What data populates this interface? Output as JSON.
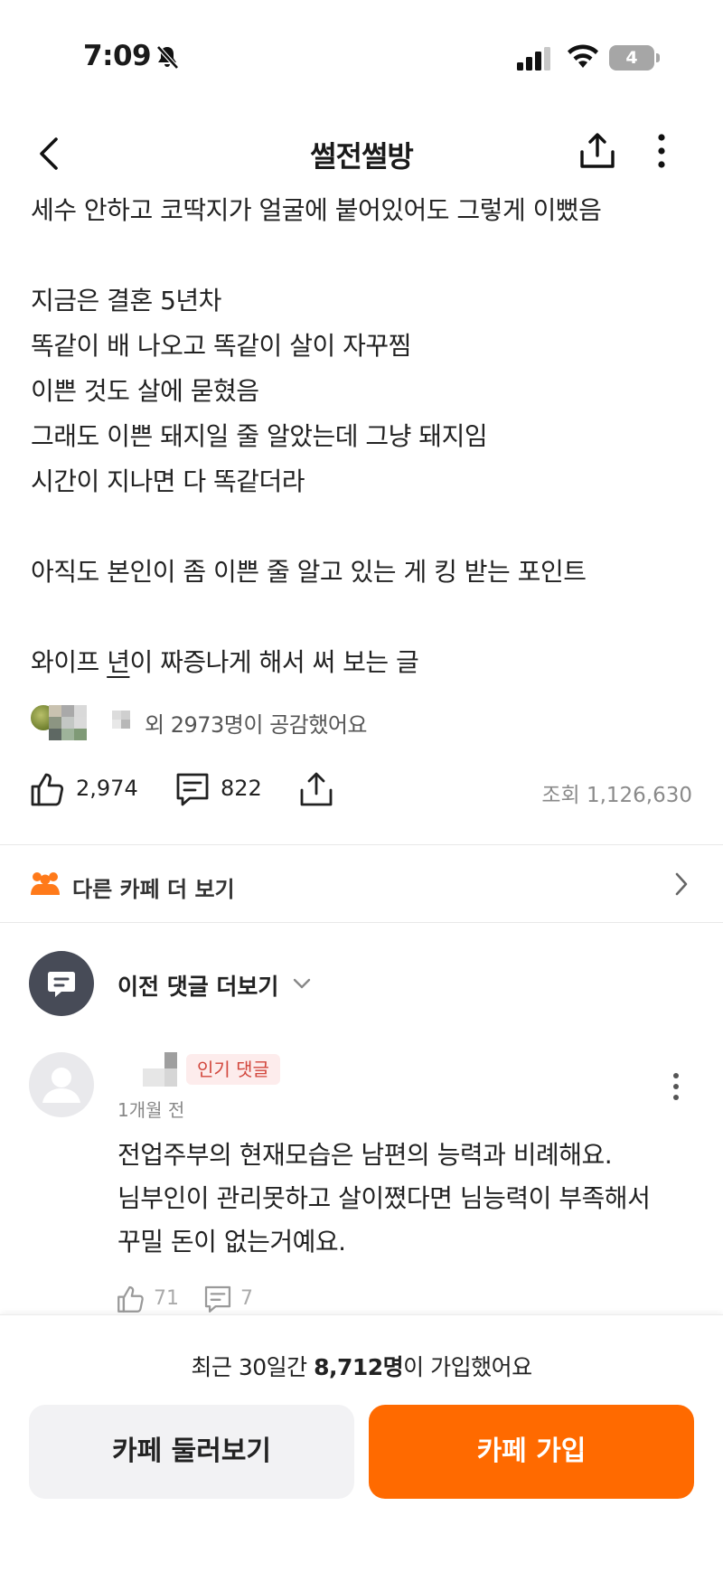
{
  "status_bar": {
    "time": "7:09",
    "battery_level": "4"
  },
  "nav": {
    "title": "썰전썰방"
  },
  "post": {
    "lines": [
      "세수 안하고 코딱지가 얼굴에 붙어있어도 그렇게 이뻤음",
      "",
      "지금은 결혼 5년차",
      "똑같이 배 나오고 똑같이 살이 자꾸찜",
      "이쁜 것도 살에 묻혔음",
      "그래도 이쁜 돼지일 줄 알았는데 그냥 돼지임",
      "시간이 지나면 다 똑같더라",
      "",
      "아직도 본인이 좀 이쁜 줄 알고 있는 게 킹 받는 포인트",
      "",
      "와이프 년이 짜증나게 해서 써 보는 글"
    ],
    "last_line_parts": {
      "before": "와이프 ",
      "underlined": "년",
      "after": "이 짜증나게 해서 써 보는 글"
    }
  },
  "likers": {
    "text": "외 2973명이 공감했어요"
  },
  "actions": {
    "like_count": "2,974",
    "comment_count": "822",
    "views": "조회 1,126,630"
  },
  "other_cafes": {
    "label": "다른 카페 더 보기"
  },
  "previous_comments": {
    "label": "이전 댓글 더보기"
  },
  "comment": {
    "badge": "인기 댓글",
    "time": "1개월 전",
    "lines": [
      "전업주부의 현재모습은 남편의 능력과 비례해요.",
      "님부인이 관리못하고 살이쪘다면 님능력이 부족해서",
      "꾸밀 돈이 없는거예요."
    ],
    "like_count": "71",
    "reply_count": "7"
  },
  "bottom": {
    "join_stat_prefix": "최근 30일간 ",
    "join_stat_number": "8,712명",
    "join_stat_suffix": "이 가입했어요",
    "browse_label": "카페 둘러보기",
    "join_label": "카페 가입"
  },
  "colors": {
    "accent": "#ff6a00",
    "badge_text": "#d2463c",
    "badge_bg": "#fdecec"
  }
}
